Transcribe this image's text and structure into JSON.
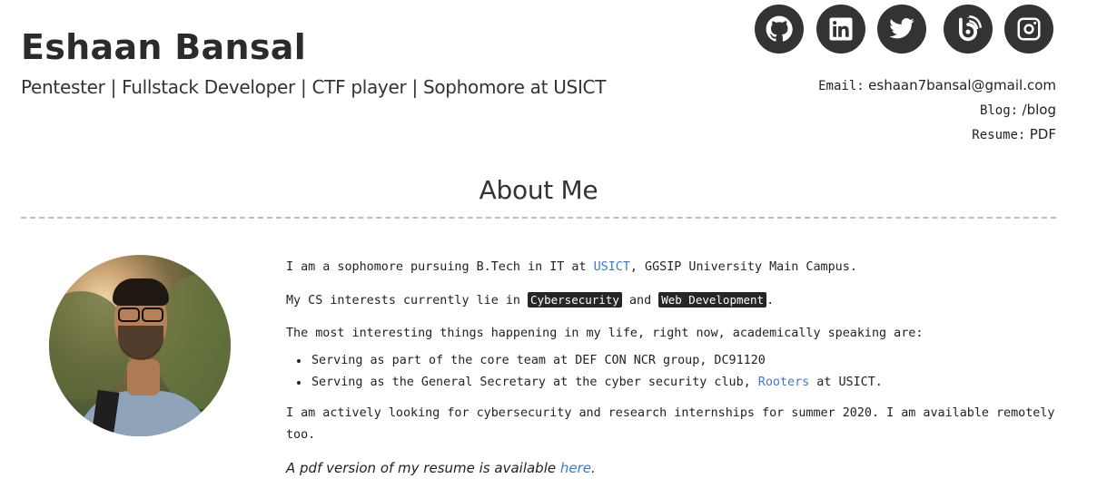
{
  "header": {
    "name": "Eshaan Bansal",
    "tagline": "Pentester | Fullstack Developer | CTF player | Sophomore at USICT"
  },
  "socials": [
    {
      "name": "github-icon"
    },
    {
      "name": "linkedin-icon"
    },
    {
      "name": "twitter-icon"
    },
    {
      "name": "blog-icon"
    },
    {
      "name": "instagram-icon"
    }
  ],
  "contact": {
    "email_key": "Email:",
    "email_val": "eshaan7bansal@gmail.com",
    "blog_key": "Blog:",
    "blog_val": "/blog",
    "resume_key": "Resume:",
    "resume_val": "PDF"
  },
  "about": {
    "title": "About Me",
    "p1_pre": "I am a sophomore pursuing B.Tech in IT at ",
    "p1_link": "USICT",
    "p1_post": ", GGSIP University Main Campus.",
    "p2_pre": "My CS interests currently lie in ",
    "p2_tag1": "Cybersecurity",
    "p2_mid": " and ",
    "p2_tag2": "Web Development",
    "p2_post": ".",
    "p3": "The most interesting things happening in my life, right now, academically speaking are:",
    "li1": "Serving as part of the core team at DEF CON NCR group, DC91120",
    "li2_pre": "Serving as the General Secretary at the cyber security club, ",
    "li2_link": "Rooters",
    "li2_post": " at USICT.",
    "p4": "I am actively looking for cybersecurity and research internships for summer 2020. I am available remotely too.",
    "p5_pre": "A pdf version of my resume is available ",
    "p5_link": "here",
    "p5_post": "."
  }
}
